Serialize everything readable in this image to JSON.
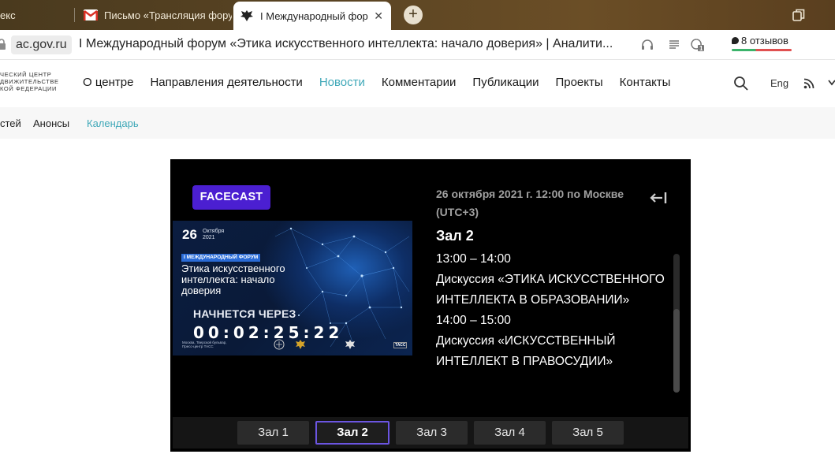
{
  "browser": {
    "tabs": [
      {
        "title": "екс"
      },
      {
        "title": "Письмо «Трансляция фору"
      },
      {
        "title": "I Международный фор"
      }
    ],
    "new_tab_glyph": "+",
    "close_glyph": "✕",
    "address": {
      "domain": "ac.gov.ru",
      "page_title": "I Международный форум «Этика искусственного интеллекта: начало доверия» | Аналити...",
      "reviews": "8 отзывов",
      "badge_count": "1"
    }
  },
  "site": {
    "logo_lines": [
      "ческий центр",
      "движительстве",
      "кой федерации"
    ],
    "nav": [
      {
        "label": "О центре"
      },
      {
        "label": "Направления деятельности"
      },
      {
        "label": "Новости",
        "active": true
      },
      {
        "label": "Комментарии"
      },
      {
        "label": "Публикации"
      },
      {
        "label": "Проекты"
      },
      {
        "label": "Контакты"
      }
    ],
    "lang": "Eng",
    "subnav": [
      {
        "label": "стей"
      },
      {
        "label": "Анонсы"
      },
      {
        "label": "Календарь",
        "active": true
      }
    ]
  },
  "player": {
    "badge": "FACECAST",
    "poster": {
      "day": "26",
      "month": "Октября",
      "year": "2021",
      "tag": "I МЕЖДУНАРОДНЫЙ ФОРУМ",
      "title": "Этика искусственного интеллекта: начало доверия",
      "starts_label": "НАЧНЕТСЯ ЧЕРЕЗ",
      "timer": "00:02:25:22",
      "small_text": "Москва, Тверской бульвар, Пресс-центр ТАСС",
      "tass": "ТАСС"
    },
    "date_line": "26 октября 2021 г. 12:00 по Москве (UTC+3)",
    "hall_title": "Зал 2",
    "schedule": [
      {
        "time": "13:00 – 14:00",
        "talk": "Дискуссия «ЭТИКА ИСКУССТВЕННОГО ИНТЕЛЛЕКТА В ОБРАЗОВАНИИ»"
      },
      {
        "time": "14:00 – 15:00",
        "talk": "Дискуссия «ИСКУССТВЕННЫЙ ИНТЕЛЛЕКТ В ПРАВОСУДИИ»"
      }
    ],
    "halls": [
      {
        "label": "Зал 1"
      },
      {
        "label": "Зал 2",
        "active": true
      },
      {
        "label": "Зал 3"
      },
      {
        "label": "Зал 4"
      },
      {
        "label": "Зал 5"
      }
    ]
  },
  "colors": {
    "accent_link": "#3fa8b8",
    "facecast_purple": "#4b1fd1",
    "active_hall_border": "#6b55e0"
  }
}
